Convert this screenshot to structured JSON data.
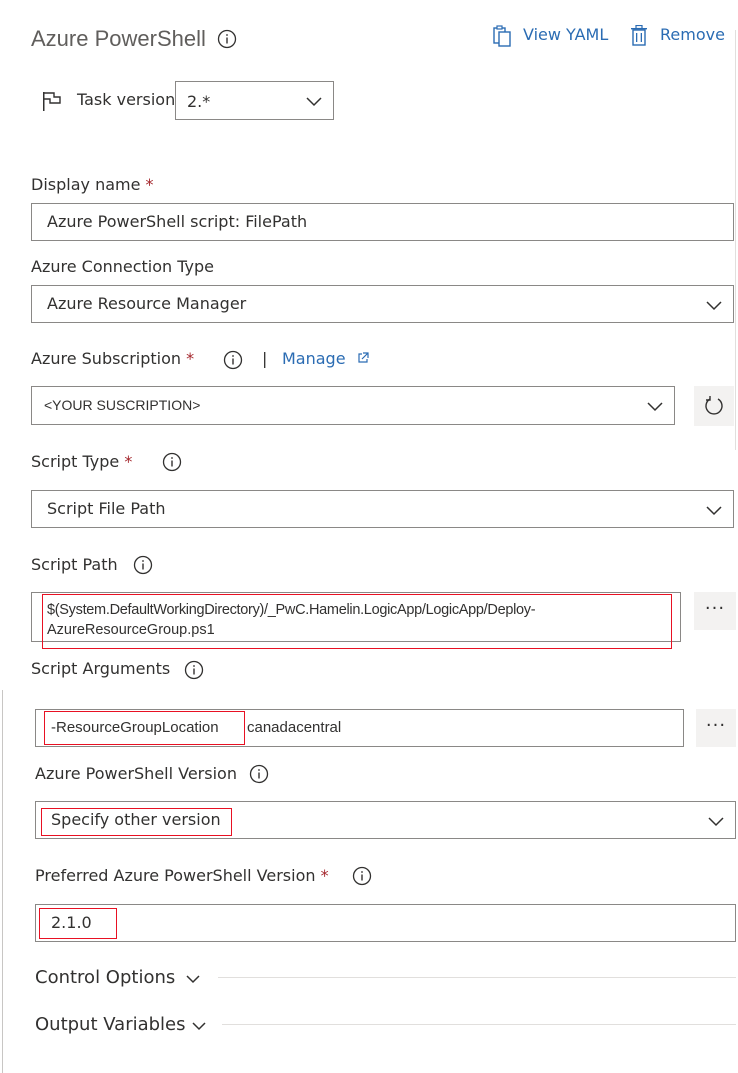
{
  "header": {
    "title": "Azure PowerShell",
    "view_yaml": "View YAML",
    "remove": "Remove",
    "info_icon": "info-icon",
    "yaml_icon": "clipboard-icon",
    "remove_icon": "trash-icon"
  },
  "task_version": {
    "label": "Task version",
    "value": "2.*",
    "icon": "flag-icon"
  },
  "display_name": {
    "label": "Display name",
    "required": "*",
    "value": "Azure PowerShell script: FilePath"
  },
  "connection_type": {
    "label": "Azure Connection Type",
    "value": "Azure Resource Manager"
  },
  "subscription": {
    "label": "Azure Subscription",
    "required": "*",
    "separator": "|",
    "manage": "Manage",
    "value": "<YOUR SUSCRIPTION>",
    "refresh_icon": "refresh-icon"
  },
  "script_type": {
    "label": "Script Type",
    "required": "*",
    "value": "Script File Path"
  },
  "script_path": {
    "label": "Script Path",
    "value_line1": "$(System.DefaultWorkingDirectory)/_PwC.Hamelin.LogicApp/LogicApp/Deploy-",
    "value_line2": "AzureResourceGroup.ps1",
    "more": "···"
  },
  "script_arguments": {
    "label": "Script Arguments",
    "value_part1": "-ResourceGroupLocation",
    "value_part2": "canadacentral",
    "more": "···"
  },
  "ps_version": {
    "label": "Azure PowerShell Version",
    "value": "Specify other version"
  },
  "preferred_version": {
    "label": "Preferred Azure PowerShell Version",
    "required": "*",
    "value": "2.1.0"
  },
  "sections": {
    "control_options": "Control Options",
    "output_variables": "Output Variables"
  },
  "colors": {
    "link": "#2b6cb3",
    "required": "#a4262c",
    "highlight": "#e81123",
    "border": "#8a8886"
  }
}
